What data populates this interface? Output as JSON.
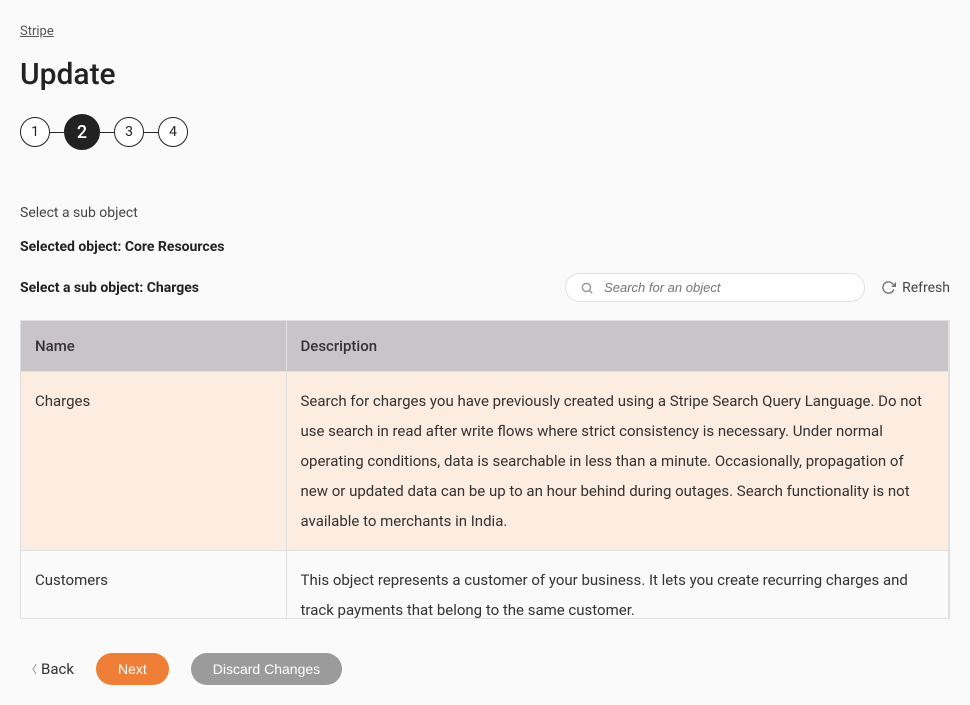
{
  "breadcrumb": "Stripe",
  "page_title": "Update",
  "stepper": {
    "steps": [
      "1",
      "2",
      "3",
      "4"
    ],
    "active_index": 1
  },
  "instruction": "Select a sub object",
  "selected_object_label": "Selected object: Core Resources",
  "select_sub_label": "Select a sub object: Charges",
  "search": {
    "placeholder": "Search for an object"
  },
  "refresh_label": "Refresh",
  "table": {
    "headers": {
      "name": "Name",
      "description": "Description"
    },
    "rows": [
      {
        "name": "Charges",
        "description": "Search for charges you have previously created using a Stripe Search Query Language. Do not use search in read after write flows where strict consistency is necessary. Under normal operating conditions, data is searchable in less than a minute. Occasionally, propagation of new or updated data can be up to an hour behind during outages. Search functionality is not available to merchants in India.",
        "selected": true
      },
      {
        "name": "Customers",
        "description": "This object represents a customer of your business. It lets you create recurring charges and track payments that belong to the same customer.",
        "selected": false
      }
    ]
  },
  "buttons": {
    "back": "Back",
    "next": "Next",
    "discard": "Discard Changes"
  }
}
